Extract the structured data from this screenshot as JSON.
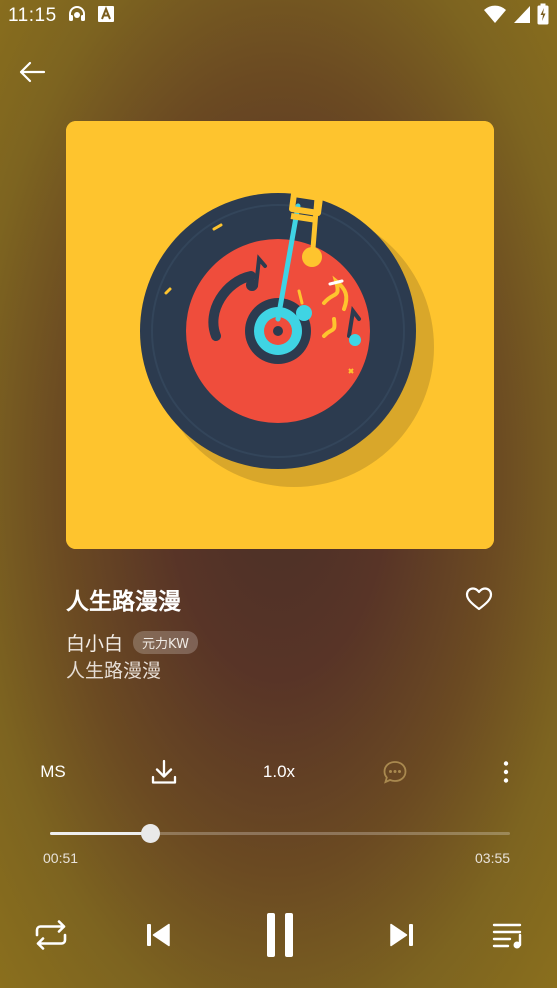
{
  "status_bar": {
    "time": "11:15",
    "icons": [
      "headset-notification-icon",
      "font-a-notification-icon",
      "wifi-icon",
      "signal-icon",
      "battery-charging-icon"
    ]
  },
  "header": {
    "back_icon": "arrow-left-icon"
  },
  "song": {
    "title": "人生路漫漫",
    "artist": "白小白",
    "source_badge": "元力KW",
    "album": "人生路漫漫",
    "favorite_icon": "heart-outline-icon"
  },
  "actions": {
    "quality_label": "MS",
    "download_icon": "download-icon",
    "speed_label": "1.0x",
    "comment_icon": "comment-icon",
    "more_icon": "more-vertical-icon"
  },
  "playback": {
    "current_time": "00:51",
    "total_time": "03:55",
    "progress": 0.217
  },
  "controls": {
    "repeat_icon": "repeat-icon",
    "previous_icon": "skip-previous-icon",
    "pause_icon": "pause-icon",
    "next_icon": "skip-next-icon",
    "playlist_icon": "playlist-icon"
  },
  "colors": {
    "album_bg": "#fec42e",
    "record_dark": "#2b3a4d",
    "record_label": "#ef4d3c",
    "accent_cyan": "#3fd4e4"
  }
}
